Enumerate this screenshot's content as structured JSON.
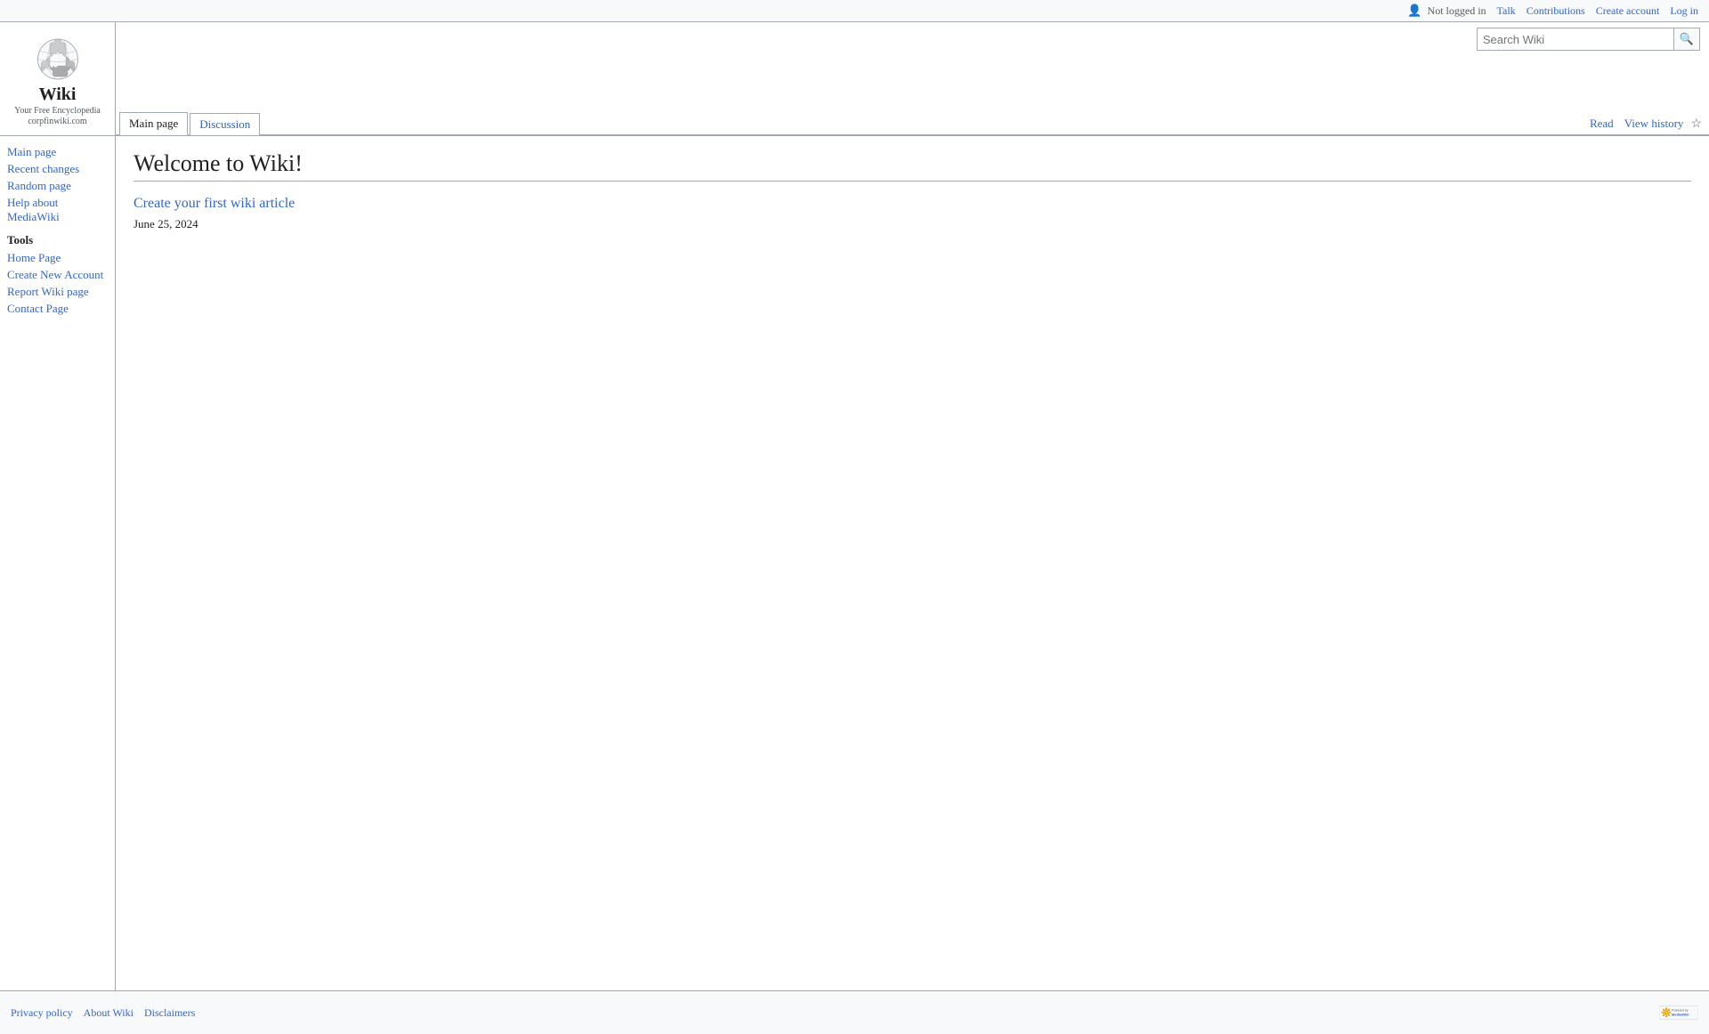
{
  "topbar": {
    "not_logged_in": "Not logged in",
    "talk": "Talk",
    "contributions": "Contributions",
    "create_account": "Create account",
    "login": "Log in"
  },
  "logo": {
    "title": "Wiki",
    "tagline": "Your Free Encyclopedia",
    "domain": "corpfinwiki.com"
  },
  "tabs": {
    "main_page": "Main page",
    "discussion": "Discussion",
    "read": "Read",
    "view_history": "View history"
  },
  "search": {
    "placeholder": "Search Wiki",
    "button_label": "🔍"
  },
  "sidebar": {
    "navigation_label": "",
    "nav_links": [
      {
        "label": "Main page"
      },
      {
        "label": "Recent changes"
      },
      {
        "label": "Random page"
      },
      {
        "label": "Help about MediaWiki"
      }
    ],
    "tools_label": "Tools",
    "tools_links": [
      {
        "label": "Home Page"
      },
      {
        "label": "Create New Account"
      },
      {
        "label": "Report Wiki page"
      },
      {
        "label": "Contact Page"
      }
    ]
  },
  "content": {
    "page_title": "Welcome to Wiki!",
    "article_link": "Create your first wiki article",
    "article_date": "June 25, 2024"
  },
  "footer": {
    "privacy_policy": "Privacy policy",
    "about_wiki": "About Wiki",
    "disclaimers": "Disclaimers",
    "powered_by": "Powered by"
  }
}
